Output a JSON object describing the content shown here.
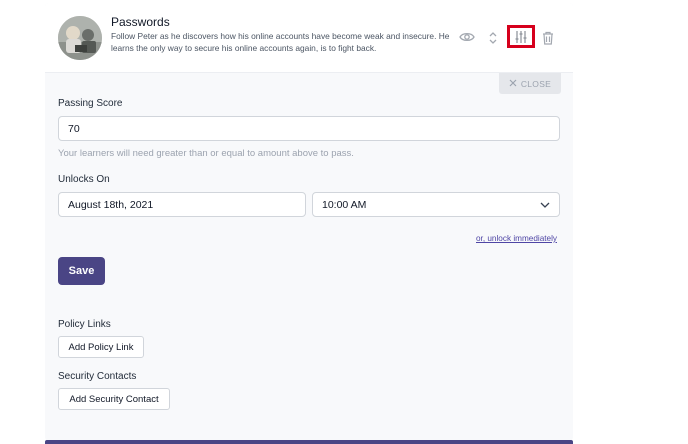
{
  "module": {
    "title": "Passwords",
    "description": "Follow Peter as he discovers how his online accounts have become weak and insecure. He learns the only way to secure his online accounts again, is to fight back.",
    "icons": [
      "eye-icon",
      "chevron-up-down-icon",
      "sliders-icon",
      "trash-icon"
    ]
  },
  "close_label": "CLOSE",
  "passing_score": {
    "label": "Passing Score",
    "value": "70",
    "help": "Your learners will need greater than or equal to amount above to pass."
  },
  "unlocks": {
    "label": "Unlocks On",
    "date": "August 18th, 2021",
    "time": "10:00 AM",
    "unlock_now": "or, unlock immediately"
  },
  "save_label": "Save",
  "policy_links": {
    "label": "Policy Links",
    "button": "Add Policy Link"
  },
  "security_contacts": {
    "label": "Security Contacts",
    "button": "Add Security Contact"
  },
  "colors": {
    "primary": "#4a4585",
    "highlight": "#d6001c"
  }
}
